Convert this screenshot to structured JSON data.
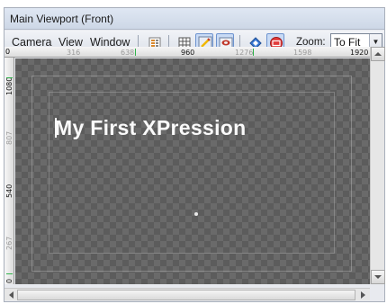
{
  "window": {
    "title": "Main Viewport (Front)"
  },
  "menu": {
    "items": [
      {
        "label": "Camera"
      },
      {
        "label": "View"
      },
      {
        "label": "Window"
      }
    ]
  },
  "toolbar": {
    "zoom_label": "Zoom:",
    "zoom_value": "To Fit",
    "buttons": [
      {
        "name": "properties-icon"
      },
      {
        "name": "grid-icon"
      },
      {
        "name": "draw-icon",
        "active": true
      },
      {
        "name": "camera-icon",
        "active": true
      },
      {
        "name": "layer-icon"
      },
      {
        "name": "safe-area-icon",
        "active": true
      }
    ]
  },
  "ruler_h": {
    "origin": "0",
    "labels": [
      "316",
      "638",
      "960",
      "1276",
      "1598",
      "1920"
    ]
  },
  "ruler_v": {
    "labels": [
      "1080",
      "807",
      "540",
      "267",
      "0"
    ]
  },
  "viewport": {
    "text": "My First XPression"
  },
  "colors": {
    "accent": "#6d93cf",
    "marker": "#2fb34a",
    "canvas": "#6a6a6a"
  }
}
